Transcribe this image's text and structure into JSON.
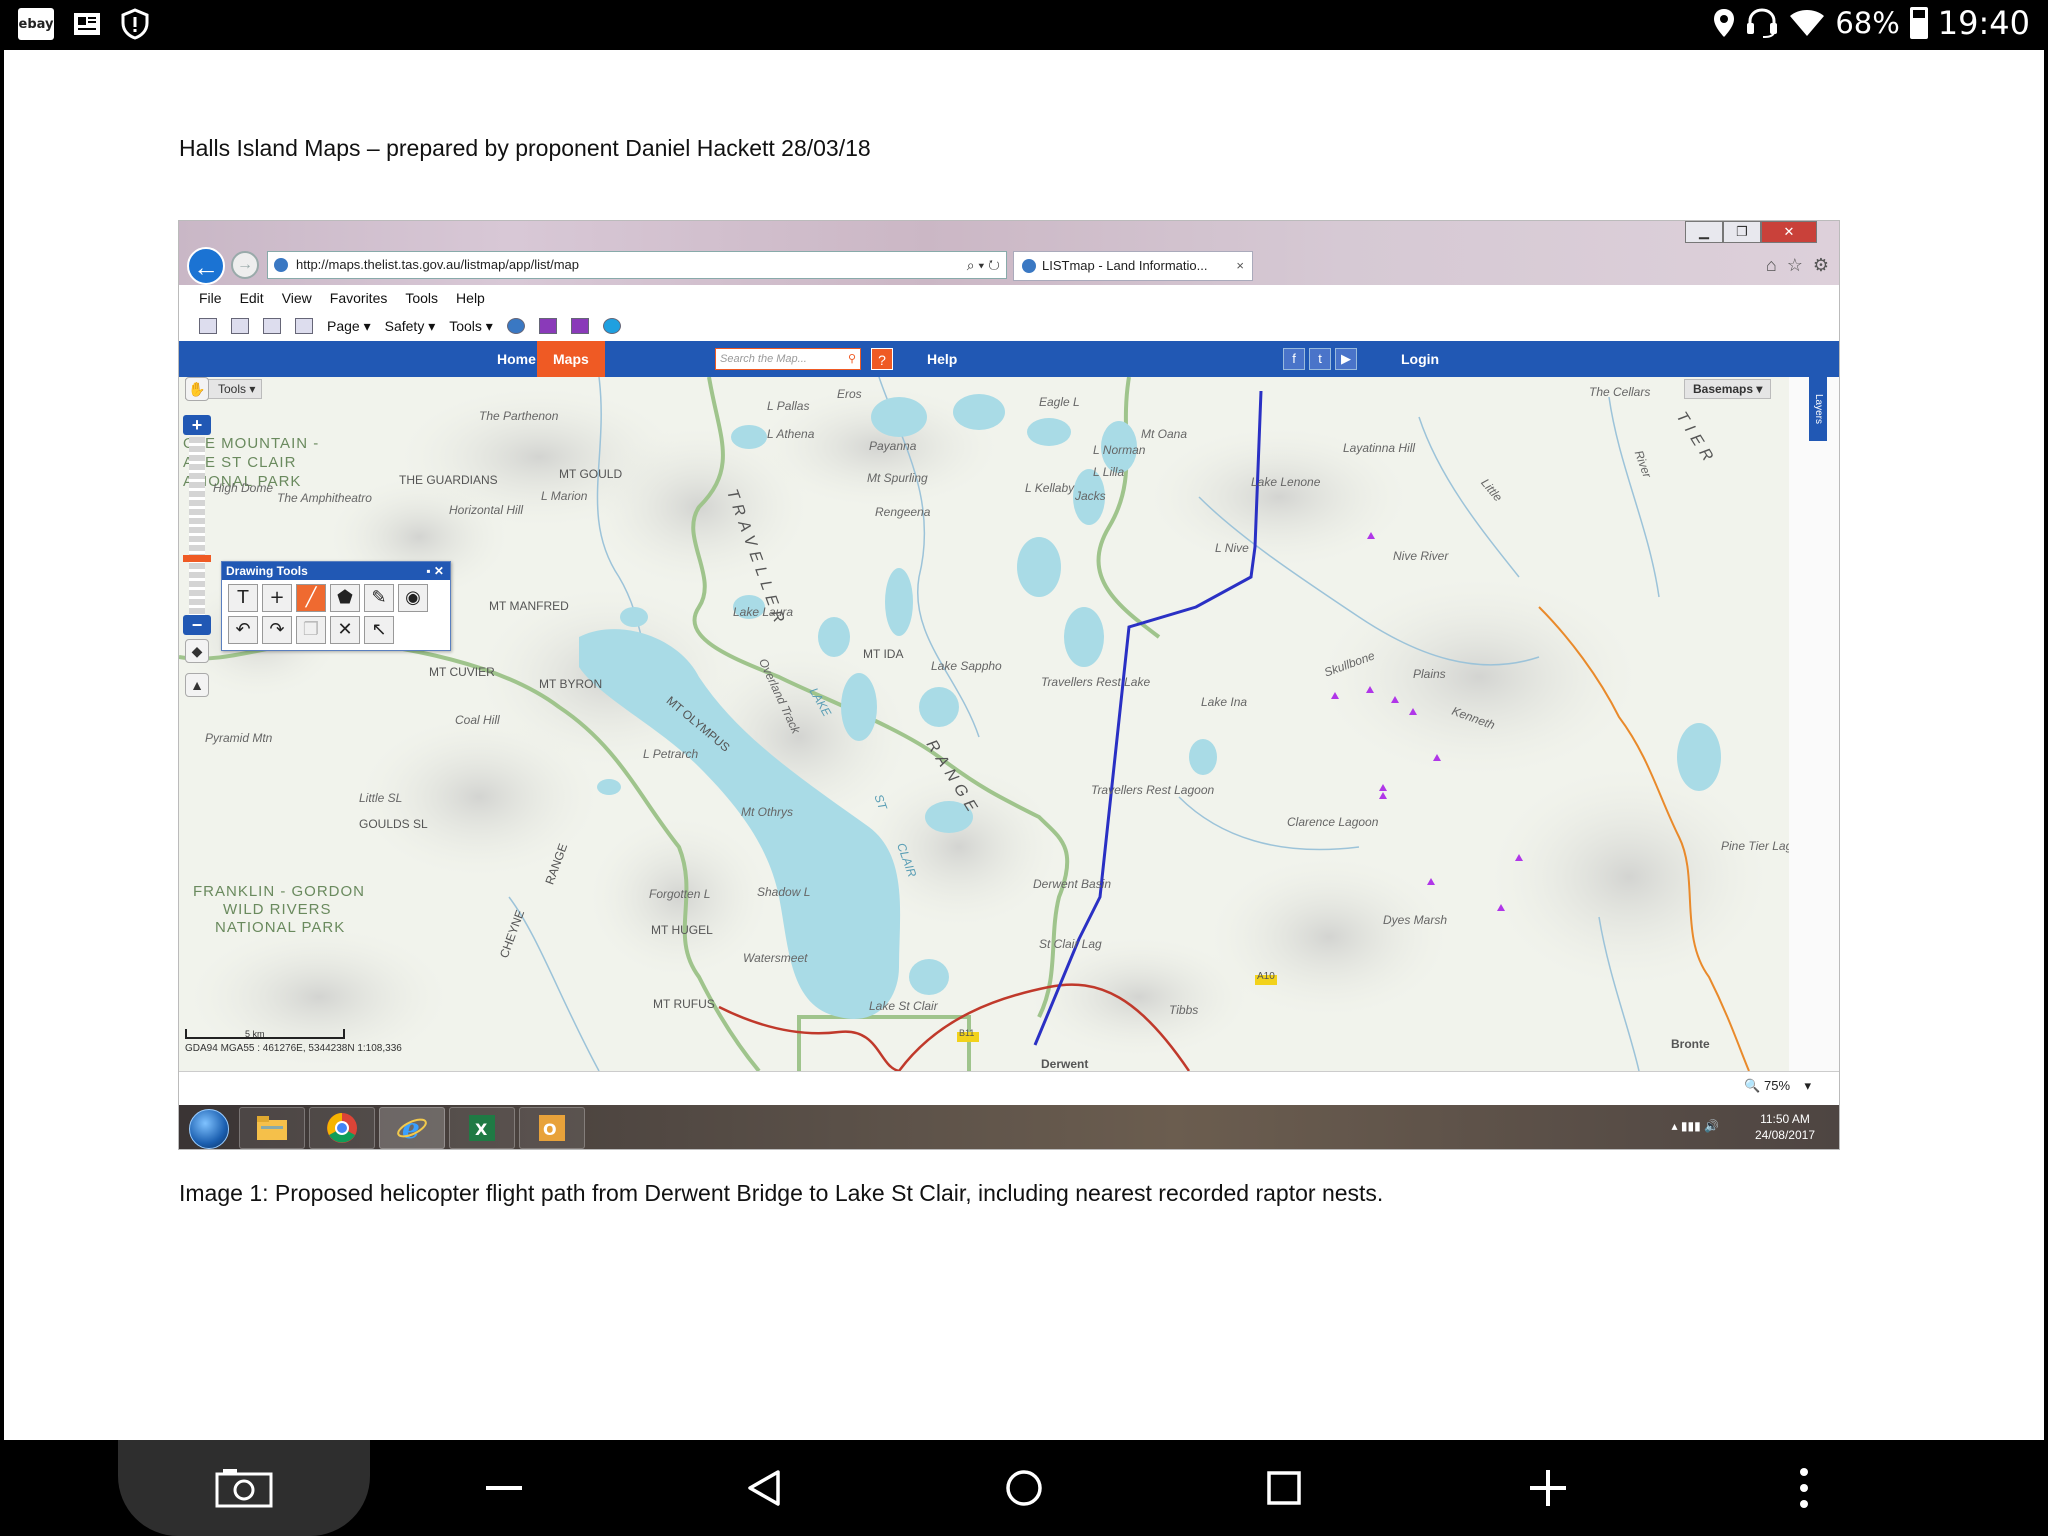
{
  "status_bar": {
    "battery": "68%",
    "time": "19:40",
    "app_icons": [
      "ebay-icon",
      "news-icon",
      "shield-icon"
    ],
    "right_icons": [
      "location-icon",
      "headset-icon",
      "wifi-icon",
      "battery-icon"
    ],
    "ebay_text": "ebay"
  },
  "document": {
    "title": "Halls Island Maps – prepared by proponent Daniel Hackett 28/03/18",
    "caption": "Image 1: Proposed helicopter flight path from Derwent Bridge to Lake St Clair, including nearest recorded raptor nests."
  },
  "browser": {
    "url": "http://maps.thelist.tas.gov.au/listmap/app/list/map",
    "tab_title": "LISTmap - Land Informatio...",
    "menu": [
      "File",
      "Edit",
      "View",
      "Favorites",
      "Tools",
      "Help"
    ],
    "commands": [
      "Page ▾",
      "Safety ▾",
      "Tools ▾"
    ]
  },
  "listmap_nav": {
    "home": "Home",
    "maps": "Maps",
    "search_placeholder": "Search the Map...",
    "help_mark": "?",
    "help": "Help",
    "login": "Login"
  },
  "map": {
    "tools_label": "Tools",
    "basemaps_label": "Basemaps",
    "layers_label": "Layers",
    "drawing_tools_title": "Drawing Tools",
    "scale_text": "5 km",
    "coords": "GDA94 MGA55 : 461276E, 5344238N 1:108,336",
    "zoom_level": "75%",
    "labels": {
      "park1": "CRADLE MOUNTAIN - LAKE ST CLAIR NATIONAL PARK",
      "park1_a": "OLE MOUNTAIN -",
      "park1_b": "AKE ST CLAIR",
      "park1_c": "ATIONAL PARK",
      "park2_a": "FRANKLIN - GORDON",
      "park2_b": "WILD RIVERS",
      "park2_c": "NATIONAL PARK",
      "traveller": "TRAVELLER",
      "range": "RANGE",
      "tier": "TIER",
      "lake_st_clair_a": "LAKE",
      "lake_st_clair_b": "ST",
      "lake_st_clair_c": "CLAIR",
      "the_guardians": "THE GUARDIANS",
      "mt_gould": "MT GOULD",
      "mt_manfred": "MT MANFRED",
      "mt_cuvier": "MT CUVIER",
      "mt_byron": "MT BYRON",
      "mt_ida": "MT IDA",
      "mt_olympus": "MT OLYMPUS",
      "mt_hugel": "MT HUGEL",
      "mt_rufus": "MT RUFUS",
      "mt_othrys": "Mt Othrys",
      "mt_oana": "Mt Oana",
      "goulds": "GOULDS SL",
      "cheyne": "CHEYNE",
      "range2": "RANGE",
      "the_parthenon": "The Parthenon",
      "high_dome": "High Dome",
      "the_amphitheatro": "The Amphitheatro",
      "horizontal_hill": "Horizontal Hill",
      "coal_hill": "Coal Hill",
      "pyramid_mtn": "Pyramid Mtn",
      "little_sl": "Little SL",
      "l_marion": "L Marion",
      "l_pallas": "L Pallas",
      "l_athena": "L Athena",
      "l_norman": "L Norman",
      "l_lilla": "L Lilla",
      "l_kellaby": "L Kellaby",
      "l_petrarch": "L Petrarch",
      "l_nive": "L Nive",
      "lake_lenone": "Lake Lenone",
      "lake_laura": "Lake Laura",
      "lake_sappho": "Lake Sappho",
      "travellers_rest_lake": "Travellers Rest Lake",
      "travellers_rest_lagoon": "Travellers Rest Lagoon",
      "lake_ina": "Lake Ina",
      "clarence_lagoon": "Clarence Lagoon",
      "derwent_basin": "Derwent Basin",
      "st_clair_lag": "St Clair Lag",
      "lake_st_clair_town": "Lake St Clair",
      "shadow_l": "Shadow L",
      "forgotten_l": "Forgotten L",
      "watersmeet": "Watersmeet",
      "tibbs": "Tibbs",
      "derwent": "Derwent",
      "bronte": "Bronte",
      "layatinna_hill": "Layatinna Hill",
      "the_cellars": "The Cellars",
      "skullbone": "Skullbone",
      "plains": "Plains",
      "dyes_marsh": "Dyes Marsh",
      "pine_tier_lagoon": "Pine Tier Lagoon",
      "nive_river": "Nive River",
      "little": "Little",
      "river": "River",
      "a10": "A10",
      "b11": "B11",
      "mt_spurling": "Mt Spurling",
      "payanna": "Payanna",
      "mt_rengeena": "Rengeena",
      "overland_track": "Overland Track",
      "eros": "Eros",
      "eagle_l": "Eagle L",
      "jacks": "Jacks",
      "kenneth": "Kenneth"
    }
  },
  "taskbar": {
    "time": "11:50 AM",
    "date": "24/08/2017",
    "apps": [
      "start-orb",
      "file-explorer-icon",
      "chrome-icon",
      "ie-icon",
      "excel-icon",
      "outlook-icon"
    ]
  },
  "android_nav": {
    "buttons": [
      "screenshot-icon",
      "minus-icon",
      "back-icon",
      "home-icon",
      "recents-icon",
      "plus-icon",
      "more-icon"
    ]
  },
  "colors": {
    "listmap_blue": "#2158b4",
    "listmap_orange": "#ef5a24",
    "flight_path": "#2a30c4",
    "raptor_nest": "#b036e8",
    "water": "#a9dbe6",
    "park_boundary": "#9fc48c"
  }
}
